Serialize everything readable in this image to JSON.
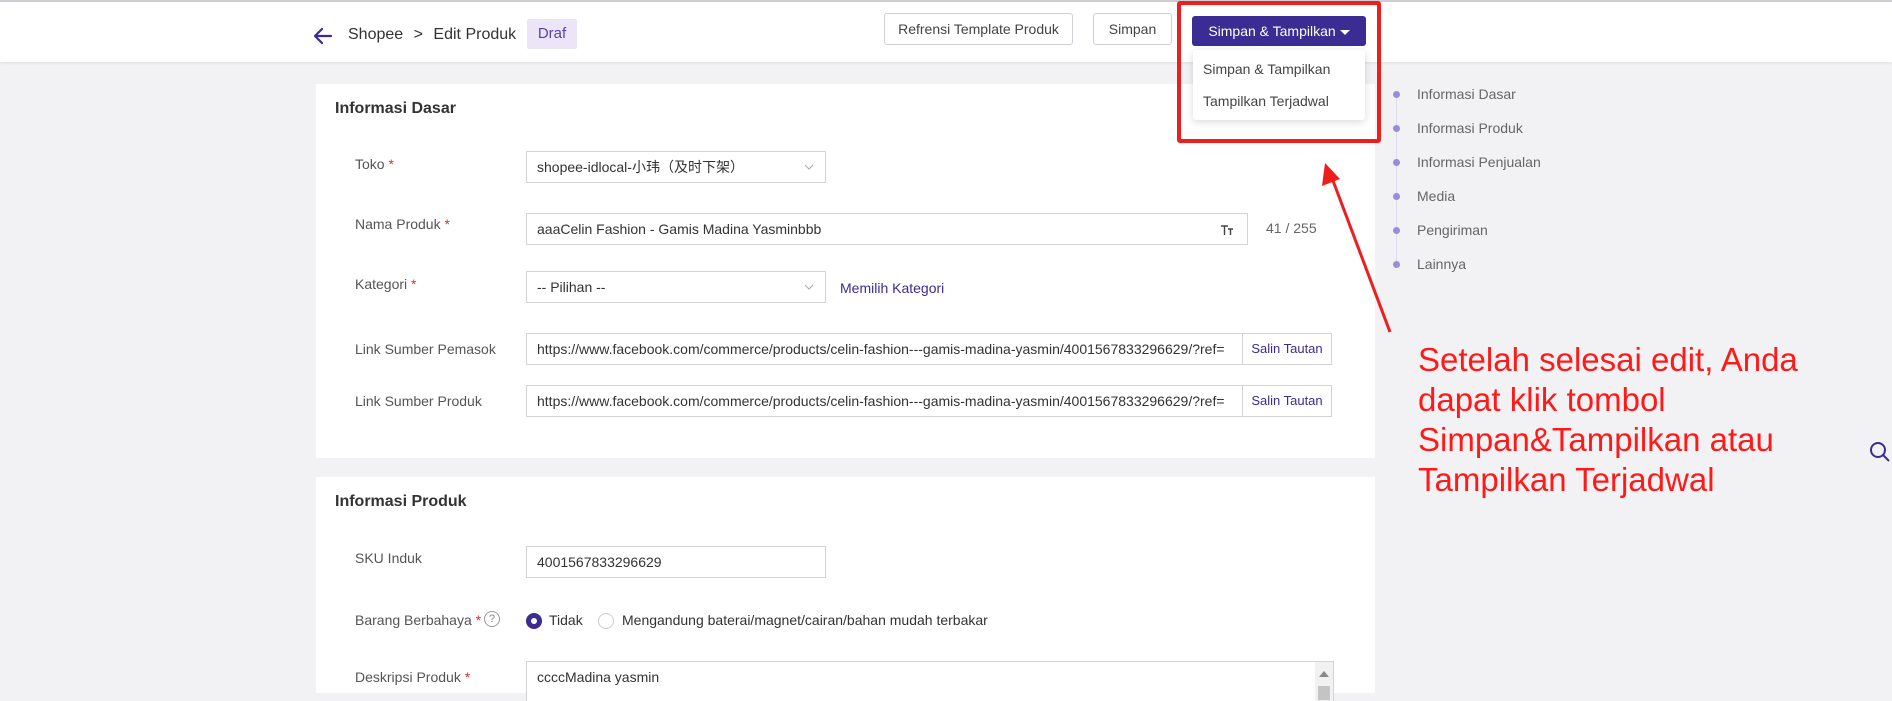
{
  "header": {
    "breadcrumb_root": "Shopee",
    "breadcrumb_sep": ">",
    "breadcrumb_current": "Edit Produk",
    "status_badge": "Draf",
    "btn_template": "Refrensi Template Produk",
    "btn_save": "Simpan",
    "btn_save_publish": "Simpan & Tampilkan"
  },
  "dropdown": {
    "options": [
      "Simpan & Tampilkan",
      "Tampilkan Terjadwal"
    ]
  },
  "annotation": {
    "note": "Setelah selesai edit, Anda dapat klik tombol Simpan&Tampilkan atau Tampilkan Terjadwal",
    "color": "#ff1a1a"
  },
  "basic_info": {
    "title": "Informasi Dasar",
    "store_label": "Toko",
    "store_value": "shopee-idlocal-小玮（及时下架）",
    "name_label": "Nama Produk",
    "name_value": "aaaCelin Fashion - Gamis Madina Yasminbbb",
    "name_counter": "41 / 255",
    "category_label": "Kategori",
    "category_value": "-- Pilihan --",
    "category_link": "Memilih Kategori",
    "supplier_link_label": "Link Sumber Pemasok",
    "supplier_link_value": "https://www.facebook.com/commerce/products/celin-fashion---gamis-madina-yasmin/4001567833296629/?ref=",
    "product_link_label": "Link Sumber Produk",
    "product_link_value": "https://www.facebook.com/commerce/products/celin-fashion---gamis-madina-yasmin/4001567833296629/?ref=",
    "copy_link": "Salin Tautan",
    "required_mark": "*"
  },
  "product_info": {
    "title": "Informasi Produk",
    "sku_label": "SKU Induk",
    "sku_value": "4001567833296629",
    "dangerous_label": "Barang Berbahaya",
    "help_mark": "?",
    "option_no": "Tidak",
    "option_yes": "Mengandung baterai/magnet/cairan/bahan mudah terbakar",
    "selected_option": "Tidak",
    "desc_label": "Deskripsi Produk",
    "desc_value": "ccccMadina yasmin"
  },
  "anchor_nav": {
    "items": [
      "Informasi Dasar",
      "Informasi Produk",
      "Informasi Penjualan",
      "Media",
      "Pengiriman",
      "Lainnya"
    ]
  },
  "colors": {
    "primary": "#3b2c93",
    "badge_bg": "#ebe5f7",
    "highlight": "#ef1e1e"
  }
}
